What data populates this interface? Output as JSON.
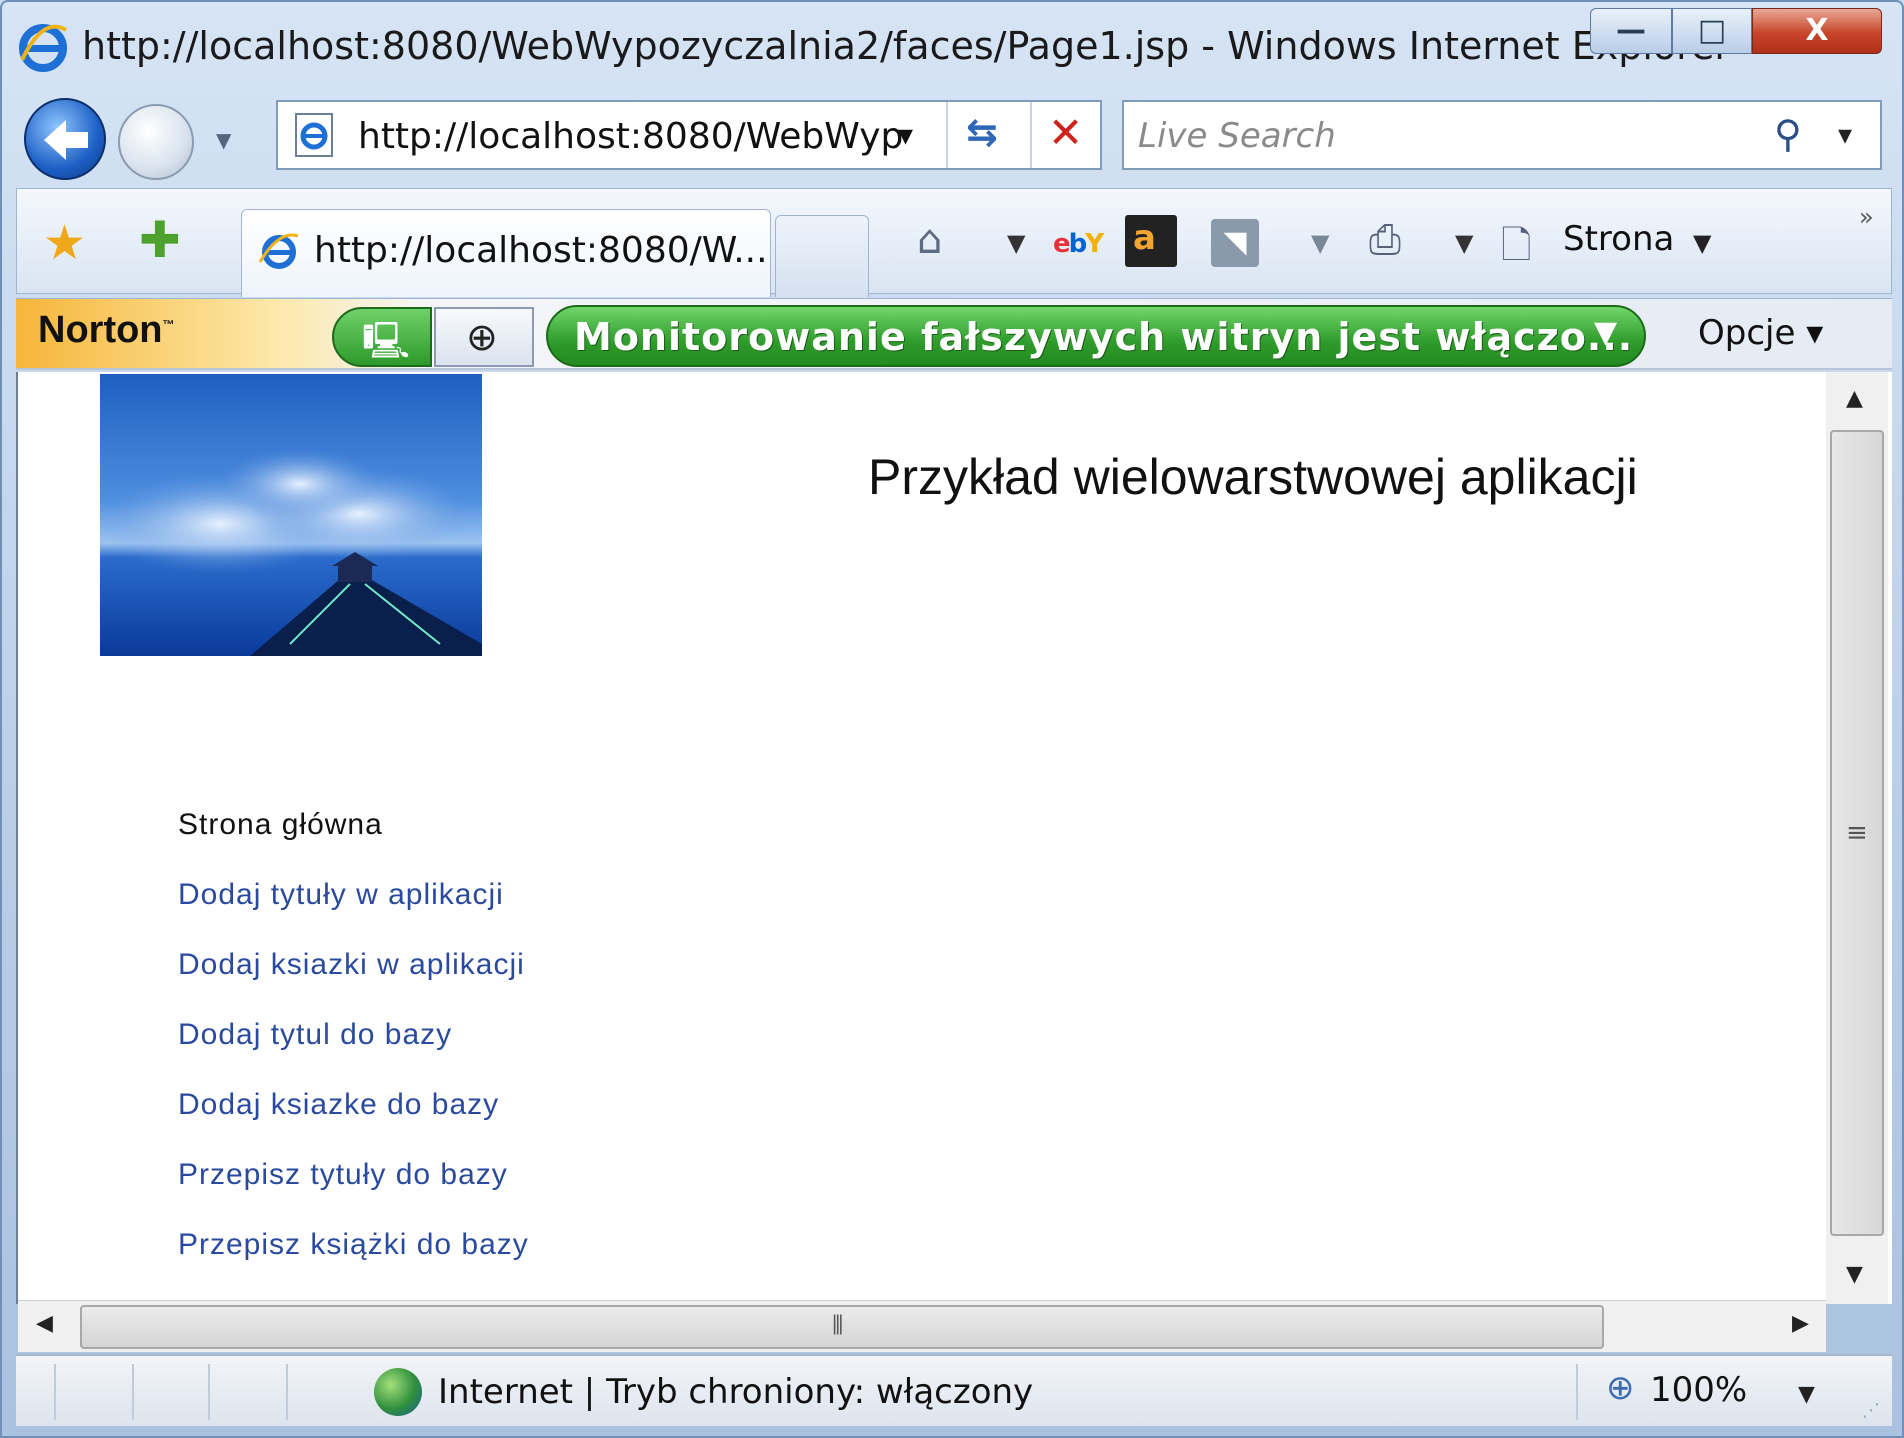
{
  "window": {
    "title": "http://localhost:8080/WebWypozyczalnia2/faces/Page1.jsp - Windows Internet Explorer",
    "minimize_glyph": "—",
    "maximize_glyph": "□",
    "close_glyph": "X"
  },
  "navigation": {
    "address": "http://localhost:8080/WebWyp",
    "search_placeholder": "Live Search"
  },
  "tabs": {
    "active_label": "http://localhost:8080/W..."
  },
  "command_bar": {
    "page_label": "Strona",
    "ebay_text": "ebY",
    "amazon_text": "a"
  },
  "norton": {
    "brand": "Norton",
    "status_text": "Monitorowanie fałszywych witryn jest włączo...",
    "options_label": "Opcje ▾"
  },
  "page": {
    "title": "Przykład wielowarstwowej aplikacji",
    "nav_items": [
      {
        "label": "Strona główna",
        "is_link": false
      },
      {
        "label": "Dodaj tytuły w aplikacji",
        "is_link": true
      },
      {
        "label": "Dodaj ksiazki w aplikacji",
        "is_link": true
      },
      {
        "label": "Dodaj tytul do bazy",
        "is_link": true
      },
      {
        "label": "Dodaj ksiazke do bazy",
        "is_link": true
      },
      {
        "label": "Przepisz tytuły do bazy",
        "is_link": true
      },
      {
        "label": "Przepisz książki do bazy",
        "is_link": true
      }
    ],
    "link_color": "#2a4aa0"
  },
  "status_bar": {
    "zone_text": "Internet | Tryb chroniony: włączony",
    "zoom_text": "100%"
  },
  "icons": [
    "ie-logo-icon",
    "back-arrow-icon",
    "forward-arrow-icon",
    "refresh-icon",
    "stop-icon",
    "search-icon",
    "favorites-star-icon",
    "add-favorite-icon",
    "home-icon",
    "ebay-icon",
    "amazon-icon",
    "rss-icon",
    "print-icon",
    "page-icon",
    "norton-pc-icon",
    "norton-globe-icon",
    "internet-zone-globe-icon",
    "zoom-icon"
  ]
}
